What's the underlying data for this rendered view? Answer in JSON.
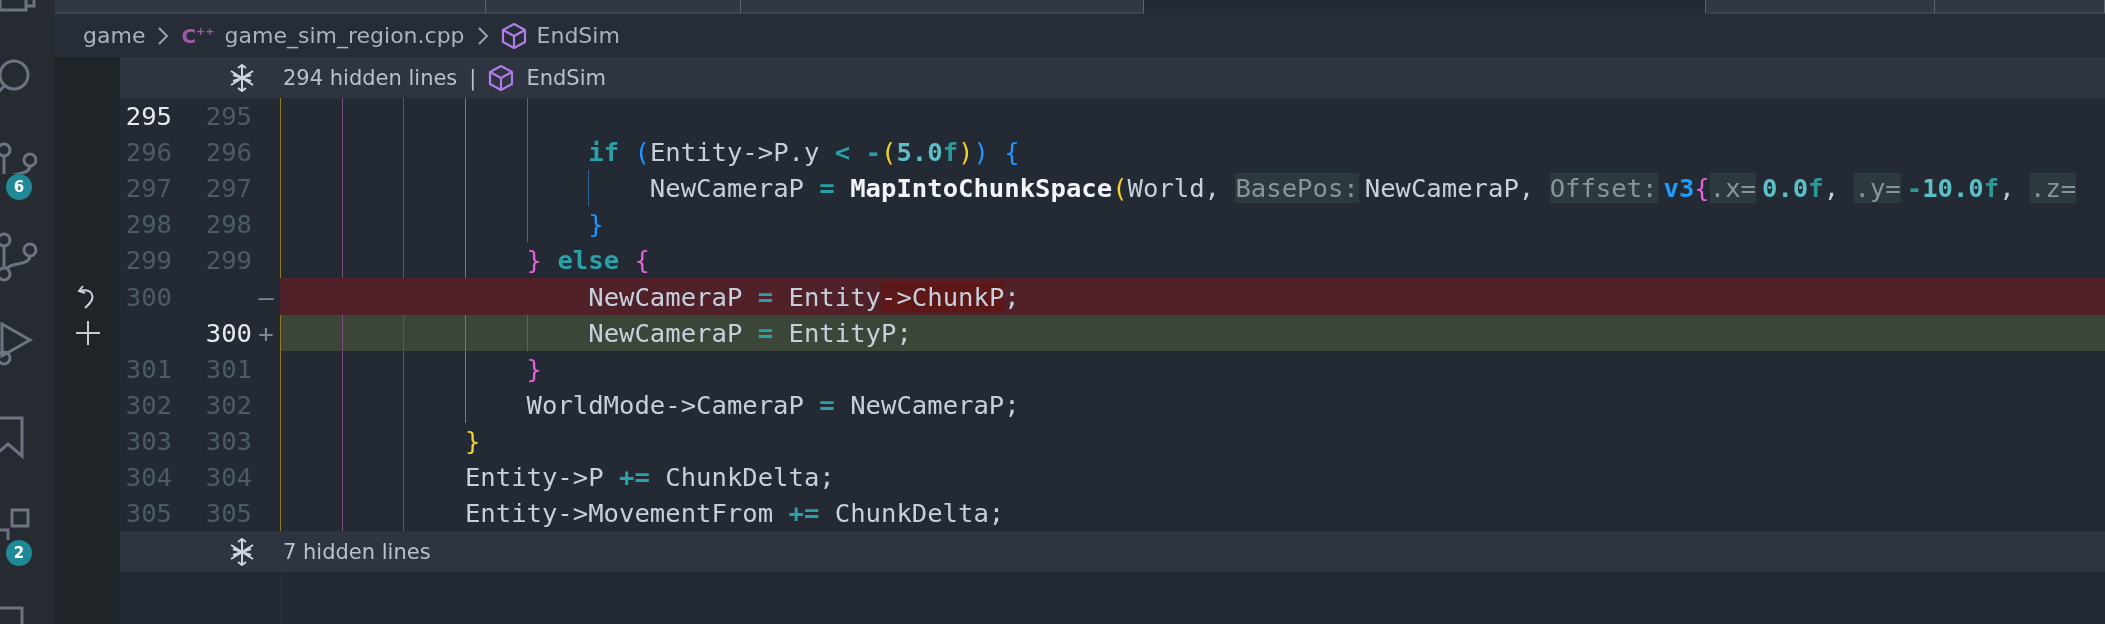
{
  "activity_bar": {
    "items": [
      {
        "selected": false
      },
      {
        "selected": false
      },
      {
        "selected": false,
        "badge": "6"
      },
      {
        "selected": false
      },
      {
        "selected": false
      },
      {
        "selected": false
      },
      {
        "selected": false,
        "badge": "2"
      },
      {
        "selected": false
      }
    ]
  },
  "tabs": [
    {
      "selected": false
    },
    {
      "selected": false
    },
    {
      "selected": false
    },
    {
      "selected": true
    },
    {
      "selected": false
    },
    {
      "selected": false
    }
  ],
  "breadcrumbs": [
    {
      "kind": "folder",
      "text": "game"
    },
    {
      "kind": "file",
      "icon_text": "C$^{++}$",
      "text": "game_sim_region.cpp"
    },
    {
      "kind": "symbol",
      "text": "EndSim"
    }
  ],
  "folds": [
    {
      "text": "294 hidden lines",
      "separator": "|",
      "symbol": "EndSim"
    },
    {
      "text": "7 hidden lines"
    }
  ],
  "lines": [
    {
      "old": "295",
      "new": "295",
      "old_active": true,
      "new_active": false,
      "kind": "context"
    },
    {
      "old": "296",
      "new": "296",
      "old_active": false,
      "new_active": false,
      "kind": "context",
      "tokens": [
        {
          "kind": "keyword",
          "text": "                    if"
        },
        {
          "kind": "bracket3",
          "text": " ("
        },
        {
          "kind": "plain",
          "text": "Entity->P.y "
        },
        {
          "kind": "operator",
          "text": "<"
        },
        {
          "kind": "operator",
          "text": " -"
        },
        {
          "kind": "bracket1",
          "text": "("
        },
        {
          "kind": "number",
          "text": "5.0"
        },
        {
          "kind": "suffix",
          "text": "f"
        },
        {
          "kind": "bracket1",
          "text": ")"
        },
        {
          "kind": "bracket3",
          "text": ")"
        },
        {
          "kind": "bracket3",
          "text": " {"
        }
      ]
    },
    {
      "old": "297",
      "new": "297",
      "old_active": false,
      "new_active": false,
      "kind": "context",
      "tokens": [
        {
          "kind": "plain",
          "text": "                        NewCameraP "
        },
        {
          "kind": "operator",
          "text": "="
        },
        {
          "kind": "function",
          "text": " MapIntoChunkSpace"
        },
        {
          "kind": "bracket1",
          "text": "("
        },
        {
          "kind": "plain",
          "text": "World, "
        },
        {
          "kind": "hint",
          "text": "BasePos:"
        },
        {
          "kind": "plain",
          "text": "NewCameraP, "
        },
        {
          "kind": "hint",
          "text": "Offset:"
        },
        {
          "kind": "type",
          "text": "v3"
        },
        {
          "kind": "bracket2",
          "text": "{"
        },
        {
          "kind": "hint",
          "text": ".x="
        },
        {
          "kind": "number",
          "text": "0.0"
        },
        {
          "kind": "suffix",
          "text": "f"
        },
        {
          "kind": "plain",
          "text": ", "
        },
        {
          "kind": "hint",
          "text": ".y="
        },
        {
          "kind": "suffix",
          "text": "-"
        },
        {
          "kind": "number",
          "text": "10.0"
        },
        {
          "kind": "suffix",
          "text": "f"
        },
        {
          "kind": "plain",
          "text": ", "
        },
        {
          "kind": "hint",
          "text": ".z="
        }
      ]
    },
    {
      "old": "298",
      "new": "298",
      "old_active": false,
      "new_active": false,
      "kind": "context",
      "tokens": [
        {
          "kind": "bracket3",
          "text": "                    }"
        }
      ]
    },
    {
      "old": "299",
      "new": "299",
      "old_active": false,
      "new_active": false,
      "kind": "context",
      "tokens": [
        {
          "kind": "bracket2",
          "text": "                }"
        },
        {
          "kind": "keyword",
          "text": " else"
        },
        {
          "kind": "bracket2",
          "text": " {"
        }
      ]
    },
    {
      "old": "300",
      "old_active": false,
      "kind": "removed",
      "marker": "—",
      "tokens": [
        {
          "kind": "plain",
          "text": "                    NewCameraP "
        },
        {
          "kind": "operator",
          "text": "="
        },
        {
          "kind": "plain",
          "text": " Entity"
        },
        {
          "kind": "changed",
          "text": "->ChunkP"
        },
        {
          "kind": "plain",
          "text": ";"
        }
      ]
    },
    {
      "new": "300",
      "new_active": true,
      "kind": "added",
      "marker": "+",
      "tokens": [
        {
          "kind": "plain",
          "text": "                    NewCameraP "
        },
        {
          "kind": "operator",
          "text": "="
        },
        {
          "kind": "plain",
          "text": " EntityP;"
        }
      ]
    },
    {
      "old": "301",
      "new": "301",
      "old_active": false,
      "new_active": false,
      "kind": "context",
      "tokens": [
        {
          "kind": "bracket2",
          "text": "                }"
        }
      ]
    },
    {
      "old": "302",
      "new": "302",
      "old_active": false,
      "new_active": false,
      "kind": "context",
      "tokens": [
        {
          "kind": "plain",
          "text": "                WorldMode->CameraP "
        },
        {
          "kind": "operator",
          "text": "="
        },
        {
          "kind": "plain",
          "text": " NewCameraP;"
        }
      ]
    },
    {
      "old": "303",
      "new": "303",
      "old_active": false,
      "new_active": false,
      "kind": "context",
      "tokens": [
        {
          "kind": "bracket1",
          "text": "            }"
        }
      ]
    },
    {
      "old": "304",
      "new": "304",
      "old_active": false,
      "new_active": false,
      "kind": "context",
      "tokens": [
        {
          "kind": "plain",
          "text": "            Entity->P "
        },
        {
          "kind": "operator",
          "text": "+="
        },
        {
          "kind": "plain",
          "text": " ChunkDelta;"
        }
      ]
    },
    {
      "old": "305",
      "new": "305",
      "old_active": false,
      "new_active": false,
      "kind": "context",
      "tokens": [
        {
          "kind": "plain",
          "text": "            Entity->MovementFrom "
        },
        {
          "kind": "operator",
          "text": "+="
        },
        {
          "kind": "plain",
          "text": " ChunkDelta;"
        }
      ]
    }
  ]
}
